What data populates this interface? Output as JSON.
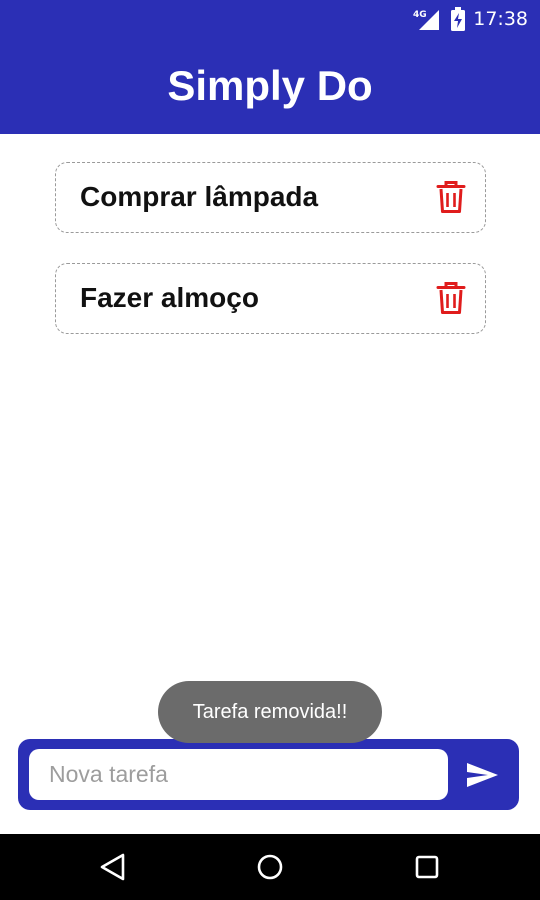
{
  "status_bar": {
    "network": "4G",
    "time": "17:38"
  },
  "app": {
    "title": "Simply Do"
  },
  "tasks": [
    {
      "label": "Comprar lâmpada"
    },
    {
      "label": "Fazer almoço"
    }
  ],
  "toast": {
    "message": "Tarefa removida!!"
  },
  "input": {
    "placeholder": "Nova tarefa",
    "value": ""
  },
  "icons": {
    "delete": "trash-icon",
    "send": "send-icon",
    "back": "back-triangle-icon",
    "home": "home-circle-icon",
    "recents": "recents-square-icon"
  },
  "colors": {
    "primary": "#2b2fb5",
    "delete": "#e01c1c",
    "toast": "#6b6b6b"
  }
}
